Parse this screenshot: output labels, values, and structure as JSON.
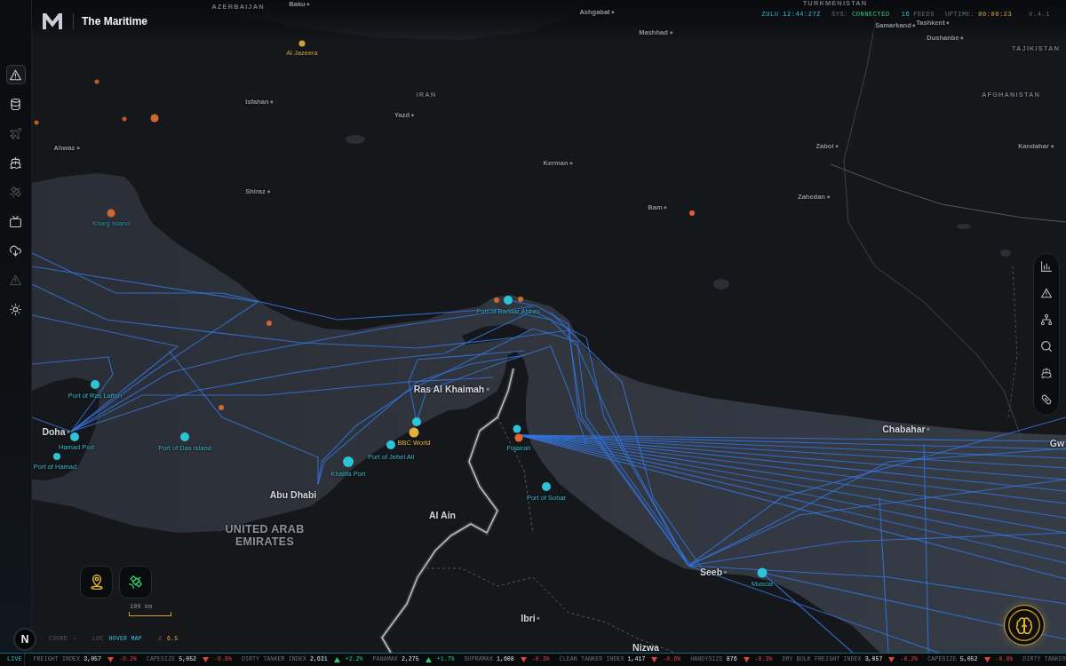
{
  "header": {
    "title": "The Maritime",
    "clock": "ZULU 12:44:27Z",
    "status_label": "SYS:",
    "status": "CONNECTED",
    "feeds_count": "16",
    "feeds_label": "FEEDS",
    "uptime_label": "UPTIME:",
    "uptime": "00:00:23",
    "version": "V.4.1"
  },
  "sidebar": {
    "items": [
      {
        "selected": true,
        "active": true
      },
      {
        "selected": false,
        "active": true
      },
      {
        "selected": false,
        "active": false
      },
      {
        "selected": false,
        "active": true
      },
      {
        "selected": false,
        "active": false
      },
      {
        "selected": false,
        "active": true
      },
      {
        "selected": false,
        "active": true
      },
      {
        "selected": false,
        "active": false
      },
      {
        "selected": false,
        "active": true
      }
    ]
  },
  "map": {
    "labels": [
      {
        "text": "AZERBAIJAN",
        "kind": "region"
      },
      {
        "text": "Baku",
        "kind": "town"
      },
      {
        "text": "TURKMENISTAN",
        "kind": "region"
      },
      {
        "text": "Ashgabat",
        "kind": "town"
      },
      {
        "text": "Mashhad",
        "kind": "town"
      },
      {
        "text": "Samarkand",
        "kind": "town"
      },
      {
        "text": "Tashkent",
        "kind": "town"
      },
      {
        "text": "Dushanbe",
        "kind": "town"
      },
      {
        "text": "TAJIKISTAN",
        "kind": "region"
      },
      {
        "text": "IRAN",
        "kind": "region"
      },
      {
        "text": "AFGHANISTAN",
        "kind": "region"
      },
      {
        "text": "Isfahan",
        "kind": "town"
      },
      {
        "text": "Yazd",
        "kind": "town"
      },
      {
        "text": "Ahwaz",
        "kind": "town"
      },
      {
        "text": "Zabol",
        "kind": "town"
      },
      {
        "text": "Kandahar",
        "kind": "town"
      },
      {
        "text": "Kerman",
        "kind": "town"
      },
      {
        "text": "Shiraz",
        "kind": "town"
      },
      {
        "text": "Zahedan",
        "kind": "town"
      },
      {
        "text": "Bam",
        "kind": "town"
      },
      {
        "text": "Ras Al Khaimah",
        "kind": "city"
      },
      {
        "text": "Chabahar",
        "kind": "city"
      },
      {
        "text": "Doha",
        "kind": "city"
      },
      {
        "text": "Gw",
        "kind": "city"
      },
      {
        "text": "Abu Dhabi",
        "kind": "city"
      },
      {
        "text": "Al Ain",
        "kind": "city"
      },
      {
        "text": "UNITED ARAB EMIRATES",
        "kind": "country"
      },
      {
        "text": "Seeb",
        "kind": "city"
      },
      {
        "text": "Ibri",
        "kind": "city"
      },
      {
        "text": "Nizwa",
        "kind": "city"
      }
    ],
    "markers": [
      {
        "label": "Port of Bandar Abbas",
        "kind": "port",
        "color": "#2ec4d8"
      },
      {
        "label": "Port of Ras Laffan",
        "kind": "port",
        "color": "#2ec4d8"
      },
      {
        "label": "Hamad Port",
        "kind": "port",
        "color": "#2ec4d8"
      },
      {
        "label": "Port of Hamad",
        "kind": "port",
        "color": "#2ec4d8"
      },
      {
        "label": "Port of Das Island",
        "kind": "port",
        "color": "#2ec4d8"
      },
      {
        "kind": "port",
        "color": "#2ec4d8"
      },
      {
        "label": "BBC World",
        "kind": "media",
        "color": "#e2b33c"
      },
      {
        "label": "Port of Jebel Ali",
        "kind": "port",
        "color": "#2ec4d8"
      },
      {
        "label": "Khalifa Port",
        "kind": "port",
        "color": "#2ec4d8"
      },
      {
        "label": "Fujairah",
        "kind": "port",
        "color": "#2ec4d8"
      },
      {
        "kind": "event",
        "color": "#e0662c"
      },
      {
        "label": "Port of Sohar",
        "kind": "port",
        "color": "#2ec4d8"
      },
      {
        "label": "Muscat",
        "kind": "port",
        "color": "#2ec4d8"
      },
      {
        "label": "Al Jazeera",
        "kind": "media",
        "color": "#c9a53c"
      },
      {
        "label": "Kharg Island",
        "kind": "event",
        "color": "#d0672e"
      },
      {
        "kind": "event",
        "color": "#d0672e"
      },
      {
        "kind": "event",
        "color": "#d0672e"
      },
      {
        "kind": "event",
        "color": "#d0672e"
      },
      {
        "kind": "event",
        "color": "#d0672e"
      },
      {
        "kind": "event",
        "color": "#d0672e"
      },
      {
        "kind": "event",
        "color": "#d0672e"
      },
      {
        "kind": "event",
        "color": "#c0582a"
      },
      {
        "kind": "event",
        "color": "#c0582a"
      },
      {
        "kind": "event",
        "color": "#c0582a"
      }
    ],
    "scale_label": "100 km",
    "compass": "N"
  },
  "map_status": {
    "coord_label": "COORD",
    "coord": "–",
    "loc_label": "LOC",
    "loc": "HOVER MAP",
    "zoom_label": "Z",
    "zoom": "6.5"
  },
  "ticker": {
    "label": "LIVE",
    "items": [
      {
        "name": "FREIGHT INDEX",
        "value": "3,057",
        "rising": false,
        "change": "-0.2%"
      },
      {
        "name": "CAPESIZE",
        "value": "5,052",
        "rising": false,
        "change": "-0.8%"
      },
      {
        "name": "DIRTY TANKER INDEX",
        "value": "2,631",
        "rising": true,
        "change": "+2.2%"
      },
      {
        "name": "PANAMAX",
        "value": "2,275",
        "rising": true,
        "change": "+1.7%"
      },
      {
        "name": "SUPRAMAX",
        "value": "1,608",
        "rising": false,
        "change": "-0.3%"
      },
      {
        "name": "CLEAN TANKER INDEX",
        "value": "1,417",
        "rising": false,
        "change": "-0.6%"
      },
      {
        "name": "HANDYSIZE",
        "value": "876",
        "rising": false,
        "change": "-0.3%"
      },
      {
        "name": "DRY BULK FREIGHT INDEX",
        "value": "3,057",
        "rising": false,
        "change": "-0.2%"
      },
      {
        "name": "CAPESIZE",
        "value": "5,052",
        "rising": false,
        "change": "-0.8%"
      },
      {
        "name": "DIRTY TANKER"
      }
    ]
  }
}
